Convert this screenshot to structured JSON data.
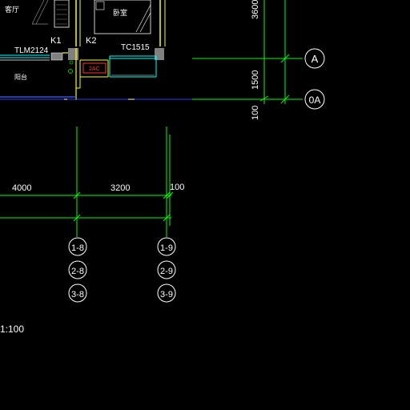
{
  "colors": {
    "background": "#000000",
    "grid_line": "#00ff00",
    "dimension_text": "#ffffff",
    "wall_yellow": "#ffff00",
    "window_cyan": "#00ffff",
    "axis_blue": "#0000ff",
    "label_white": "#ffffff",
    "gray_block": "#808080",
    "red_tag": "#ff3333",
    "small_green": "#00cc00"
  },
  "room_labels": {
    "living_room": "客厅",
    "bedroom": "卧室",
    "balcony": "阳台"
  },
  "doors": {
    "k1": "K1",
    "k2": "K2"
  },
  "windows": {
    "tlm": "TLM2124",
    "tc": "TC1515"
  },
  "tag": "2AC",
  "vertical_dimensions": {
    "top": "3600",
    "middle": "1500",
    "bottom": "100"
  },
  "horizontal_dimensions": {
    "left": "4000",
    "middle": "3200",
    "right": "100"
  },
  "grid_bubbles_right": [
    "A",
    "0A"
  ],
  "axis_labels_col8": [
    "1-8",
    "2-8",
    "3-8"
  ],
  "axis_labels_col9": [
    "1-9",
    "2-9",
    "3-9"
  ],
  "scale_text": "1:100"
}
